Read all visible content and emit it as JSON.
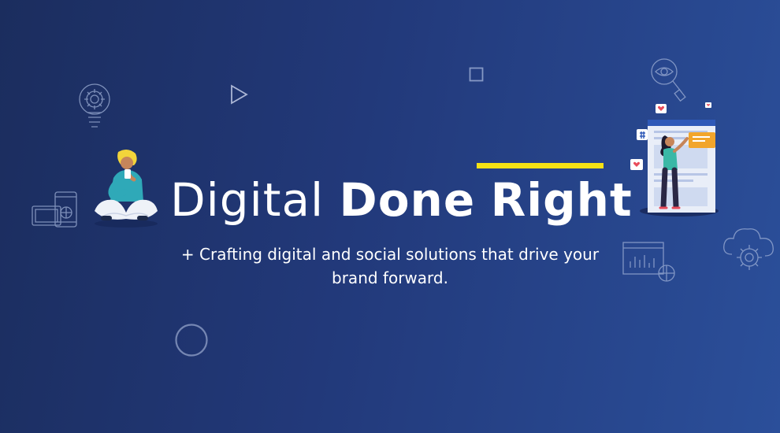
{
  "hero": {
    "headline_light": "Digital",
    "headline_bold_1": "Done",
    "headline_bold_2": "Right",
    "subtitle_line1": "+ Crafting digital and social solutions that drive your",
    "subtitle_line2": "brand forward."
  },
  "colors": {
    "background_start": "#1b2d5e",
    "background_end": "#2b4f9a",
    "accent": "#f5e214",
    "text": "#ffffff"
  },
  "icons": [
    "lightbulb-gear-icon",
    "play-icon",
    "square-outline-icon",
    "eye-magnifier-icon",
    "devices-globe-icon",
    "circle-outline-icon",
    "browser-chart-globe-icon",
    "cloud-gear-icon",
    "heart-bubble-icon",
    "hashtag-bubble-icon",
    "message-bubble-icon"
  ]
}
